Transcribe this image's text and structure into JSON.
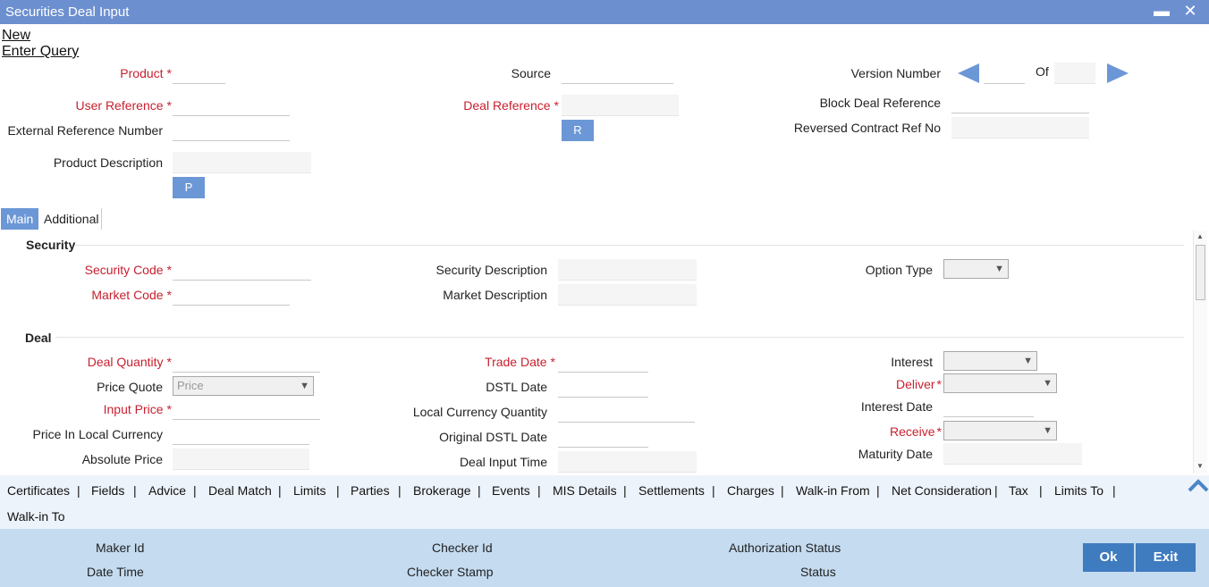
{
  "window": {
    "title": "Securities Deal Input",
    "minimize": "▬",
    "close": "✕"
  },
  "menu": {
    "new": "New",
    "enter_query": "Enter Query"
  },
  "header": {
    "product": "Product",
    "source": "Source",
    "version_number": "Version Number",
    "of": "Of",
    "user_reference": "User Reference",
    "deal_reference": "Deal Reference",
    "block_deal_reference": "Block Deal Reference",
    "external_reference_number": "External Reference Number",
    "r_button": "R",
    "reversed_contract_ref_no": "Reversed Contract Ref No",
    "product_description": "Product Description",
    "p_button": "P"
  },
  "tabs": [
    {
      "label": "Main"
    },
    {
      "label": "Additional"
    }
  ],
  "security": {
    "title": "Security",
    "security_code": "Security Code",
    "security_description": "Security Description",
    "option_type": "Option Type",
    "market_code": "Market Code",
    "market_description": "Market Description"
  },
  "deal": {
    "title": "Deal",
    "deal_quantity": "Deal Quantity",
    "trade_date": "Trade Date",
    "interest": "Interest",
    "price_quote": "Price Quote",
    "price_quote_value": "Price",
    "dstl_date": "DSTL Date",
    "deliver": "Deliver",
    "input_price": "Input Price",
    "local_currency_quantity": "Local Currency Quantity",
    "interest_date": "Interest Date",
    "price_in_local_currency": "Price In Local Currency",
    "original_dstl_date": "Original DSTL Date",
    "receive": "Receive",
    "absolute_price": "Absolute Price",
    "deal_input_time": "Deal Input Time",
    "maturity_date": "Maturity Date"
  },
  "links": [
    "Certificates",
    "Fields",
    "Advice",
    "Deal Match",
    "Limits",
    "Parties",
    "Brokerage",
    "Events",
    "MIS Details",
    "Settlements",
    "Charges",
    "Walk-in From",
    "Net Consideration",
    "Tax",
    "Limits To",
    "Walk-in To"
  ],
  "separator": "|",
  "footer": {
    "maker_id": "Maker Id",
    "date_time": "Date Time",
    "checker_id": "Checker Id",
    "checker_stamp": "Checker Stamp",
    "authorization_status": "Authorization Status",
    "status": "Status",
    "ok": "Ok",
    "exit": "Exit"
  },
  "colors": {
    "titlebar": "#6c8fd0",
    "accent": "#6c97d6",
    "required": "#c8202f",
    "footer": "#c4dbf0",
    "button": "#3f7bbf"
  }
}
